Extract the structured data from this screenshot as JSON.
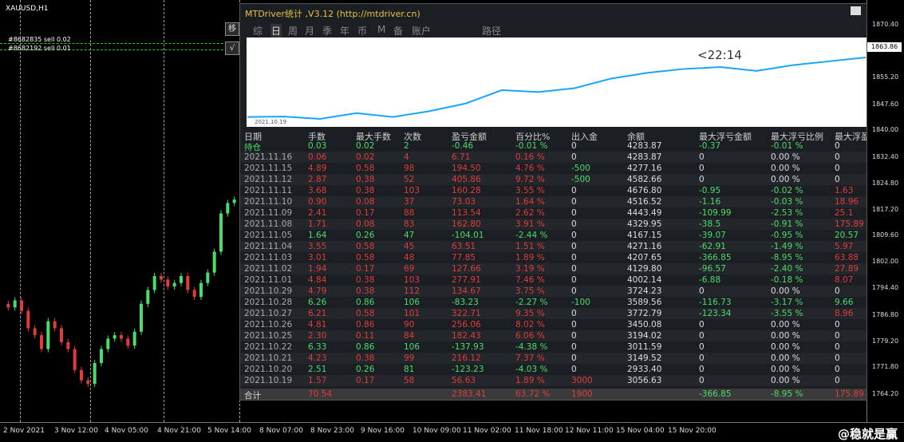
{
  "symbol": "XAUUSD,H1",
  "orders": [
    "#8682835 sell 0.02",
    "#8682192 sell 0.01"
  ],
  "current_price": "1863.86",
  "price_axis": [
    "1870.40",
    "1863.86",
    "1855.20",
    "1847.60",
    "1840.00",
    "1832.40",
    "1824.80",
    "1817.20",
    "1809.60",
    "1802.00",
    "1794.40",
    "1786.80",
    "1779.20",
    "1771.80",
    "1764.20"
  ],
  "time_axis": [
    "2 Nov 2021",
    "3 Nov 12:00",
    "4 Nov 05:00",
    "4 Nov 21:00",
    "5 Nov 14:00",
    "8 Nov 07:00",
    "8 Nov 23:00",
    "9 Nov 16:00",
    "10 Nov 09:00",
    "11 Nov 02:00",
    "11 Nov 18:00",
    "12 Nov 11:00",
    "15 Nov 04:00",
    "15 Nov 20:00"
  ],
  "watermark": "@稳就是赢",
  "side_buttons": [
    "移",
    "√"
  ],
  "panel": {
    "title": "MTDriver统计 ,V3.12 (http://mtdriver.cn)",
    "tabs": [
      "综",
      "日",
      "周",
      "月",
      "季",
      "年",
      "币",
      "M",
      "备",
      "账户",
      "路径"
    ],
    "active_tab": "日",
    "equity_start_label": "2021.10.19",
    "equity_time_label": "<22:14",
    "equity_values": [
      1.0,
      1.2,
      0.0,
      3.0,
      1.0,
      4.0,
      8.0,
      15.0,
      14.0,
      16.0,
      21.0,
      24.0,
      26.0,
      27.0,
      25.0,
      28.0,
      30.0,
      32.0
    ]
  },
  "table": {
    "headers": [
      "日期",
      "手数",
      "最大手数",
      "次数",
      "盈亏金额",
      "百分比%",
      "出入金",
      "余额",
      "最大浮亏金额",
      "最大浮亏比例",
      "最大浮盈"
    ],
    "rows": [
      {
        "cells": [
          "持仓",
          "0.03",
          "0.02",
          "2",
          "-0.46",
          "-0.01 %",
          "0",
          "4283.87",
          "-0.37",
          "-0.01 %",
          "0"
        ],
        "tone": "green"
      },
      {
        "cells": [
          "2021.11.16",
          "0.06",
          "0.02",
          "4",
          "6.71",
          "0.16 %",
          "0",
          "4283.87",
          "0",
          "0.00 %",
          "0"
        ],
        "tone": "red"
      },
      {
        "cells": [
          "2021.11.15",
          "4.89",
          "0.58",
          "98",
          "194.50",
          "4.76 %",
          "-500",
          "4277.16",
          "0",
          "0.00 %",
          "0"
        ],
        "tone": "red"
      },
      {
        "cells": [
          "2021.11.12",
          "2.87",
          "0.38",
          "52",
          "405.86",
          "9.72 %",
          "-500",
          "4582.66",
          "0",
          "0.00 %",
          "0"
        ],
        "tone": "red"
      },
      {
        "cells": [
          "2021.11.11",
          "3.68",
          "0.38",
          "103",
          "160.28",
          "3.55 %",
          "0",
          "4676.80",
          "-0.95",
          "-0.02 %",
          "1.63"
        ],
        "tone": "red"
      },
      {
        "cells": [
          "2021.11.10",
          "0.90",
          "0.08",
          "37",
          "73.03",
          "1.64 %",
          "0",
          "4516.52",
          "-1.16",
          "-0.03 %",
          "18.96"
        ],
        "tone": "red"
      },
      {
        "cells": [
          "2021.11.09",
          "2.41",
          "0.17",
          "88",
          "113.54",
          "2.62 %",
          "0",
          "4443.49",
          "-109.99",
          "-2.53 %",
          "25.1"
        ],
        "tone": "red"
      },
      {
        "cells": [
          "2021.11.08",
          "1.71",
          "0.08",
          "83",
          "162.80",
          "3.91 %",
          "0",
          "4329.95",
          "-38.5",
          "-0.91 %",
          "175.89"
        ],
        "tone": "red"
      },
      {
        "cells": [
          "2021.11.05",
          "1.64",
          "0.26",
          "47",
          "-104.01",
          "-2.44 %",
          "0",
          "4167.15",
          "-39.07",
          "-0.95 %",
          "20.57"
        ],
        "tone": "green"
      },
      {
        "cells": [
          "2021.11.04",
          "3.55",
          "0.58",
          "45",
          "63.51",
          "1.51 %",
          "0",
          "4271.16",
          "-62.91",
          "-1.49 %",
          "5.97"
        ],
        "tone": "red"
      },
      {
        "cells": [
          "2021.11.03",
          "3.01",
          "0.58",
          "48",
          "77.85",
          "1.89 %",
          "0",
          "4207.65",
          "-366.85",
          "-8.95 %",
          "63.88"
        ],
        "tone": "red"
      },
      {
        "cells": [
          "2021.11.02",
          "1.94",
          "0.17",
          "69",
          "127.66",
          "3.19 %",
          "0",
          "4129.80",
          "-96.57",
          "-2.40 %",
          "27.89"
        ],
        "tone": "red"
      },
      {
        "cells": [
          "2021.11.01",
          "4.84",
          "0.38",
          "103",
          "277.91",
          "7.46 %",
          "0",
          "4002.14",
          "-6.88",
          "-0.18 %",
          "8.07"
        ],
        "tone": "red"
      },
      {
        "cells": [
          "2021.10.29",
          "4.79",
          "0.38",
          "112",
          "134.67",
          "3.75 %",
          "0",
          "3724.23",
          "0",
          "0.00 %",
          "0"
        ],
        "tone": "red"
      },
      {
        "cells": [
          "2021.10.28",
          "6.26",
          "0.86",
          "106",
          "-83.23",
          "-2.27 %",
          "-100",
          "3589.56",
          "-116.73",
          "-3.17 %",
          "9.66"
        ],
        "tone": "green"
      },
      {
        "cells": [
          "2021.10.27",
          "6.21",
          "0.58",
          "101",
          "322.71",
          "9.35 %",
          "0",
          "3772.79",
          "-123.34",
          "-3.55 %",
          "8.96"
        ],
        "tone": "red"
      },
      {
        "cells": [
          "2021.10.26",
          "4.81",
          "0.86",
          "90",
          "256.06",
          "8.02 %",
          "0",
          "3450.08",
          "0",
          "0.00 %",
          "0"
        ],
        "tone": "red"
      },
      {
        "cells": [
          "2021.10.25",
          "2.30",
          "0.11",
          "84",
          "182.43",
          "6.06 %",
          "0",
          "3194.02",
          "0",
          "0.00 %",
          "0"
        ],
        "tone": "red"
      },
      {
        "cells": [
          "2021.10.22",
          "6.33",
          "0.86",
          "106",
          "-137.93",
          "-4.38 %",
          "0",
          "3011.59",
          "0",
          "0.00 %",
          "0"
        ],
        "tone": "green"
      },
      {
        "cells": [
          "2021.10.21",
          "4.23",
          "0.38",
          "99",
          "216.12",
          "7.37 %",
          "0",
          "3149.52",
          "0",
          "0.00 %",
          "0"
        ],
        "tone": "red"
      },
      {
        "cells": [
          "2021.10.20",
          "2.51",
          "0.26",
          "81",
          "-123.23",
          "-4.03 %",
          "0",
          "2933.40",
          "0",
          "0.00 %",
          "0"
        ],
        "tone": "green"
      },
      {
        "cells": [
          "2021.10.19",
          "1.57",
          "0.17",
          "58",
          "56.63",
          "1.89 %",
          "3000",
          "3056.63",
          "0",
          "0.00 %",
          "0"
        ],
        "tone": "red"
      }
    ],
    "total": {
      "label": "合计",
      "lots": "70.54",
      "pnl": "2383.41",
      "pct": "63.72 %",
      "deposit": "1900",
      "max_dd": "-366.85",
      "max_dd_pct": "-8.95 %",
      "max_gain": "175.89"
    }
  },
  "colors": {
    "up": "#4cdc6a",
    "down": "#e03c3c",
    "title": "#e8c23a",
    "equity_line": "#1aa3ff"
  },
  "price_series": [
    1789,
    1788,
    1790,
    1787,
    1782,
    1780,
    1776,
    1784,
    1782,
    1778,
    1776,
    1770,
    1767,
    1766,
    1772,
    1776,
    1779,
    1780,
    1779,
    1777,
    1781,
    1789,
    1793,
    1797,
    1796,
    1794,
    1795,
    1797,
    1793,
    1791,
    1795,
    1798,
    1804,
    1815,
    1818,
    1819
  ]
}
